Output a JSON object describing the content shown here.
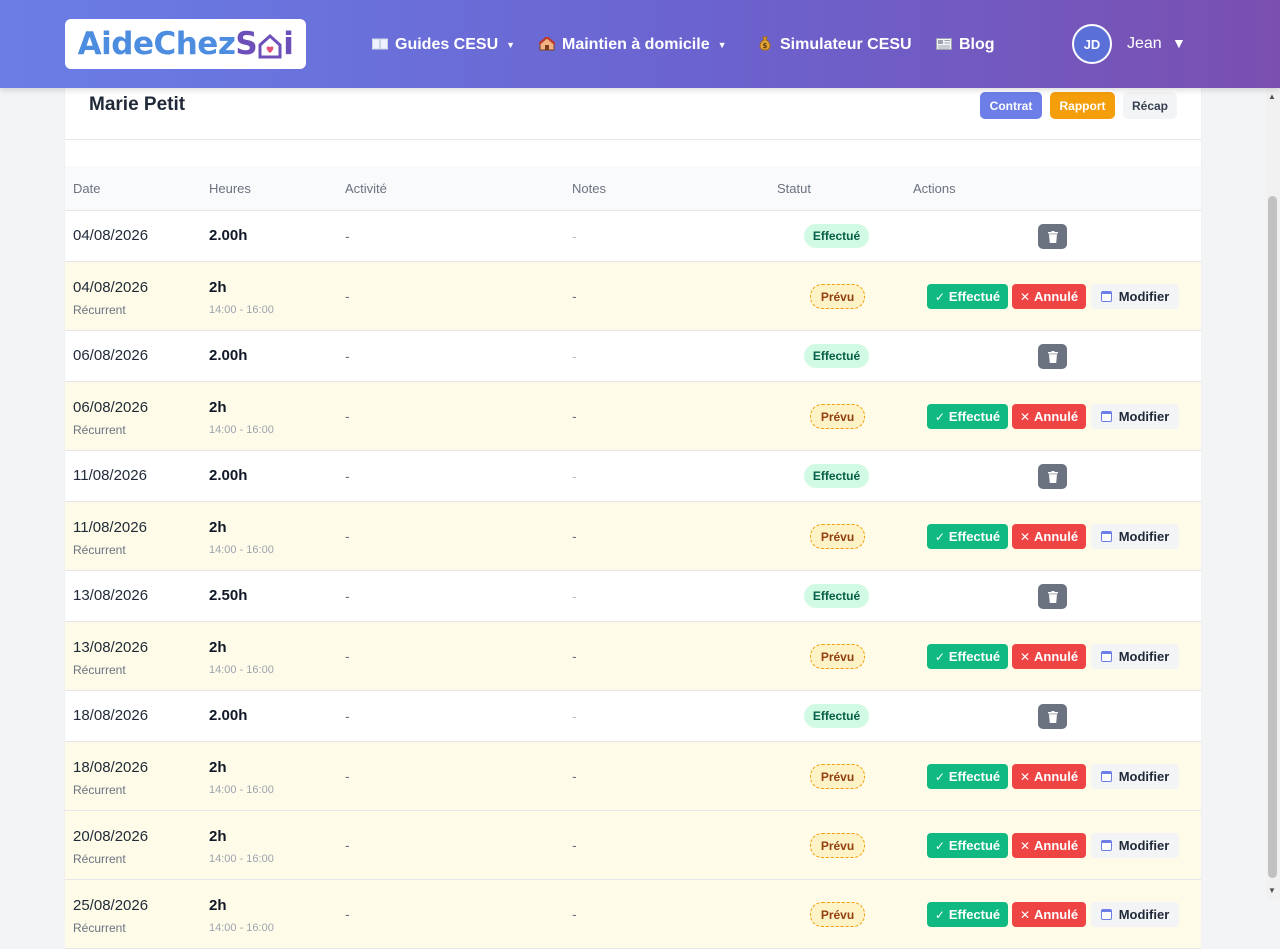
{
  "header": {
    "logo_part1": "AideChez",
    "logo_part2": "S",
    "logo_part3": "i",
    "nav": [
      {
        "label": "Guides CESU",
        "icon": "book-icon",
        "dropdown": true
      },
      {
        "label": "Maintien à domicile",
        "icon": "house-icon",
        "dropdown": true
      },
      {
        "label": "Simulateur CESU",
        "icon": "money-bag-icon",
        "dropdown": false
      },
      {
        "label": "Blog",
        "icon": "newspaper-icon",
        "dropdown": false
      }
    ],
    "user": {
      "initials": "JD",
      "name": "Jean"
    }
  },
  "card": {
    "title": "Marie Petit",
    "buttons": {
      "contrat": "Contrat",
      "rapport": "Rapport",
      "recap": "Récap"
    }
  },
  "table": {
    "columns": [
      "Date",
      "Heures",
      "Activité",
      "Notes",
      "Statut",
      "Actions"
    ],
    "rows": [
      {
        "date": "04/08/2026",
        "hours": "2.00h",
        "activity": "-",
        "notes": "-",
        "status": "Effectué",
        "type": "done"
      },
      {
        "date": "04/08/2026",
        "sub": "Récurrent",
        "hours": "2h",
        "time": "14:00 - 16:00",
        "activity": "-",
        "notes": "-",
        "status": "Prévu",
        "type": "planned"
      },
      {
        "date": "06/08/2026",
        "hours": "2.00h",
        "activity": "-",
        "notes": "-",
        "status": "Effectué",
        "type": "done"
      },
      {
        "date": "06/08/2026",
        "sub": "Récurrent",
        "hours": "2h",
        "time": "14:00 - 16:00",
        "activity": "-",
        "notes": "-",
        "status": "Prévu",
        "type": "planned"
      },
      {
        "date": "11/08/2026",
        "hours": "2.00h",
        "activity": "-",
        "notes": "-",
        "status": "Effectué",
        "type": "done"
      },
      {
        "date": "11/08/2026",
        "sub": "Récurrent",
        "hours": "2h",
        "time": "14:00 - 16:00",
        "activity": "-",
        "notes": "-",
        "status": "Prévu",
        "type": "planned"
      },
      {
        "date": "13/08/2026",
        "hours": "2.50h",
        "activity": "-",
        "notes": "-",
        "status": "Effectué",
        "type": "done"
      },
      {
        "date": "13/08/2026",
        "sub": "Récurrent",
        "hours": "2h",
        "time": "14:00 - 16:00",
        "activity": "-",
        "notes": "-",
        "status": "Prévu",
        "type": "planned"
      },
      {
        "date": "18/08/2026",
        "hours": "2.00h",
        "activity": "-",
        "notes": "-",
        "status": "Effectué",
        "type": "done"
      },
      {
        "date": "18/08/2026",
        "sub": "Récurrent",
        "hours": "2h",
        "time": "14:00 - 16:00",
        "activity": "-",
        "notes": "-",
        "status": "Prévu",
        "type": "planned"
      },
      {
        "date": "20/08/2026",
        "sub": "Récurrent",
        "hours": "2h",
        "time": "14:00 - 16:00",
        "activity": "-",
        "notes": "-",
        "status": "Prévu",
        "type": "planned"
      },
      {
        "date": "25/08/2026",
        "sub": "Récurrent",
        "hours": "2h",
        "time": "14:00 - 16:00",
        "activity": "-",
        "notes": "-",
        "status": "Prévu",
        "type": "planned"
      }
    ],
    "actions": {
      "done": "Effectué",
      "cancel": "Annulé",
      "edit": "Modifier"
    }
  },
  "colors": {
    "header_start": "#6a7ee6",
    "header_end": "#7a4fb0",
    "green": "#10b981",
    "red": "#ef4444",
    "amber": "#f59e0b",
    "indigo": "#6d7ee8",
    "planned_row_bg": "#fefce8"
  }
}
